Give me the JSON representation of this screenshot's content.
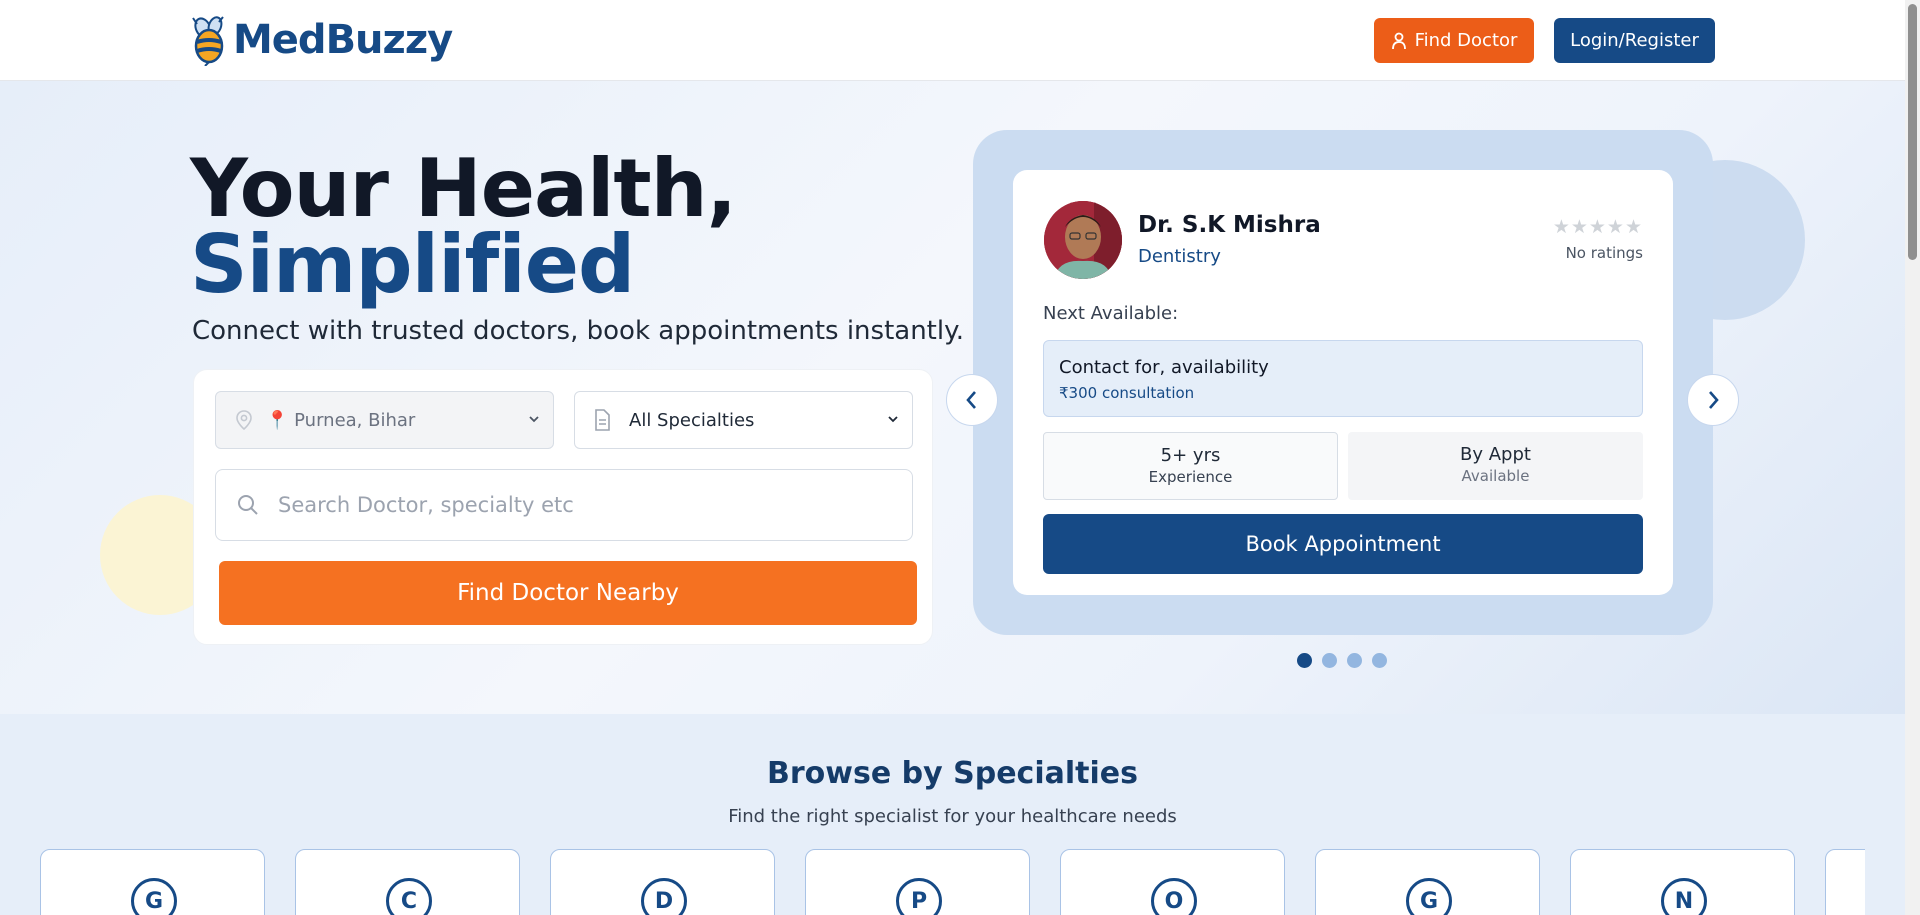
{
  "header": {
    "logo_text": "MedBuzzy",
    "find_doctor_label": "Find Doctor",
    "login_label": "Login/Register"
  },
  "hero": {
    "title_line1": "Your Health,",
    "title_line2": "Simplified",
    "subtitle": "Connect with trusted doctors, book appointments instantly.",
    "location_value": "📍 Purnea, Bihar",
    "specialty_value": "All Specialties",
    "search_placeholder": "Search Doctor, specialty etc",
    "find_nearby_label": "Find Doctor Nearby"
  },
  "doctor_card": {
    "name": "Dr. S.K Mishra",
    "specialty": "Dentistry",
    "stars": "★★★★★",
    "rating_text": "No ratings",
    "next_available_label": "Next Available:",
    "availability_text": "Contact for, availability",
    "fee_text": "₹300 consultation",
    "experience_value": "5+ yrs",
    "experience_label": "Experience",
    "availability_value": "By Appt",
    "availability_label": "Available",
    "book_label": "Book Appointment"
  },
  "carousel": {
    "dot_count": 4,
    "active_index": 0
  },
  "specialties": {
    "title": "Browse by Specialties",
    "subtitle": "Find the right specialist for your healthcare needs",
    "items": [
      {
        "letter": "G"
      },
      {
        "letter": "C"
      },
      {
        "letter": "D"
      },
      {
        "letter": "P"
      },
      {
        "letter": "O"
      },
      {
        "letter": "G"
      },
      {
        "letter": "N"
      },
      {
        "letter": ""
      }
    ]
  },
  "colors": {
    "brand_blue": "#164a86",
    "brand_orange": "#f57121"
  }
}
